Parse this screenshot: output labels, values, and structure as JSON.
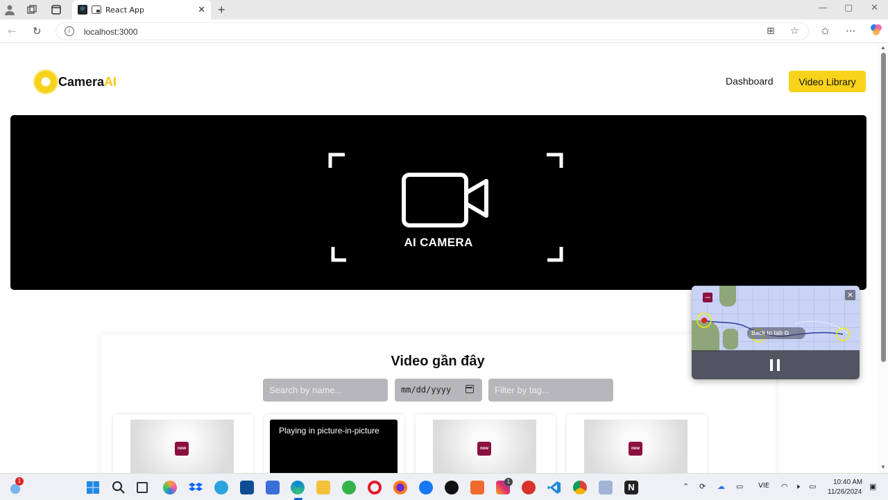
{
  "browser": {
    "tab_title": "React App",
    "url": "localhost:3000",
    "new_tab_glyph": "+",
    "close_glyph": "✕"
  },
  "header": {
    "logo_main": "Camera",
    "logo_accent": "AI",
    "nav": [
      {
        "label": "Dashboard"
      },
      {
        "label": "Video Library"
      }
    ],
    "accent_color": "#f8d21b"
  },
  "hero": {
    "label": "AI CAMERA",
    "icon": "video-camera-icon"
  },
  "videos": {
    "title": "Video gần đây",
    "search_placeholder": "Search by name...",
    "date_value": "mm/dd/yyyy",
    "tag_placeholder": "Filter by tag...",
    "cards": [
      {
        "badge": "now"
      },
      {
        "message": "Playing in picture-in-picture"
      },
      {
        "badge": "now"
      },
      {
        "badge": "now"
      }
    ]
  },
  "pip": {
    "back_label": "Back to tab",
    "badge": "now",
    "close_icon": "close-icon",
    "pause_icon": "pause-icon"
  },
  "taskbar": {
    "language": "VIE",
    "time": "10:40 AM",
    "date": "11/26/2024",
    "weather_badge": "1",
    "instagram_badge": "1"
  }
}
